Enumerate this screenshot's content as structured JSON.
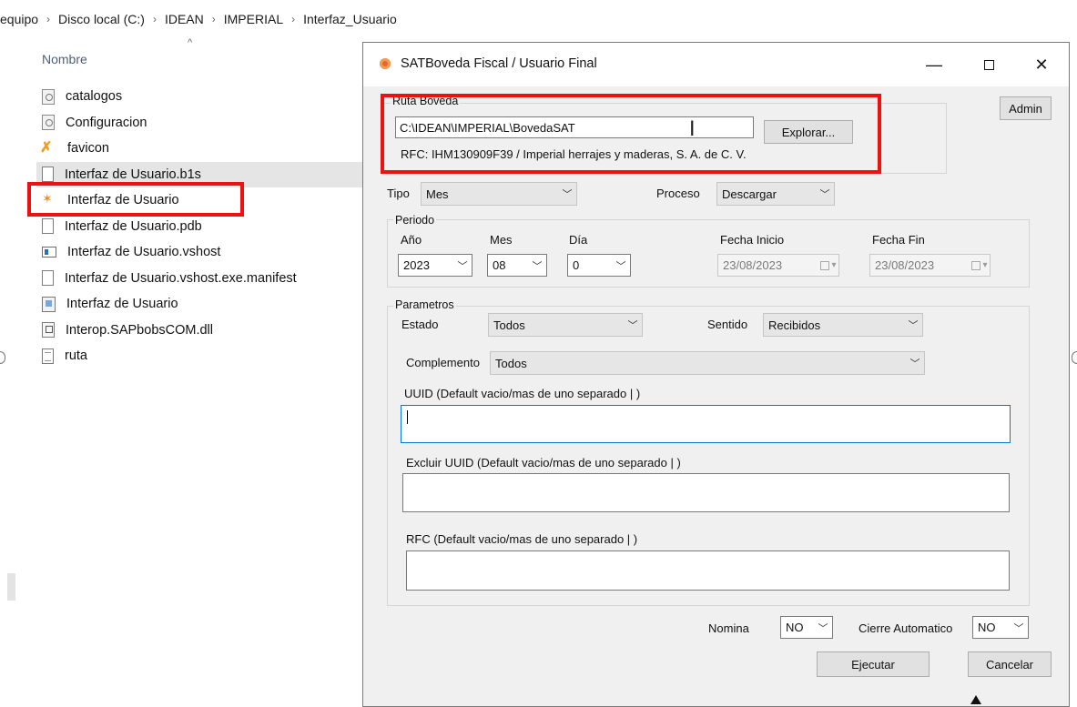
{
  "explorer": {
    "breadcrumb": [
      "equipo",
      "Disco local (C:)",
      "IDEAN",
      "IMPERIAL",
      "Interfaz_Usuario"
    ],
    "column_header": "Nombre",
    "files": [
      {
        "name": "catalogos",
        "icon": "config-file-icon"
      },
      {
        "name": "Configuracion",
        "icon": "config-file-icon"
      },
      {
        "name": "favicon",
        "icon": "favicon-icon"
      },
      {
        "name": "Interfaz de Usuario.b1s",
        "icon": "document-icon",
        "selected": true
      },
      {
        "name": "Interfaz de Usuario",
        "icon": "visual-studio-icon"
      },
      {
        "name": "Interfaz de Usuario.pdb",
        "icon": "document-icon"
      },
      {
        "name": "Interfaz de Usuario.vshost",
        "icon": "application-icon"
      },
      {
        "name": "Interfaz de Usuario.vshost.exe.manifest",
        "icon": "document-icon"
      },
      {
        "name": "Interfaz de Usuario",
        "icon": "dotnet-config-icon"
      },
      {
        "name": "Interop.SAPbobsCOM.dll",
        "icon": "dll-icon"
      },
      {
        "name": "ruta",
        "icon": "text-file-icon"
      }
    ]
  },
  "dialog": {
    "title": "SATBoveda Fiscal / Usuario Final",
    "admin_label": "Admin",
    "ruta": {
      "legend": "Ruta Boveda",
      "path_value": "C:\\IDEAN\\IMPERIAL\\BovedaSAT",
      "explore_label": "Explorar...",
      "rfc_text": "RFC: IHM130909F39 / Imperial herrajes y maderas, S. A. de C. V."
    },
    "tipo": {
      "label": "Tipo",
      "value": "Mes"
    },
    "proceso": {
      "label": "Proceso",
      "value": "Descargar"
    },
    "periodo": {
      "legend": "Periodo",
      "anio_label": "Año",
      "anio_value": "2023",
      "mes_label": "Mes",
      "mes_value": "08",
      "dia_label": "Día",
      "dia_value": "0",
      "fecha_inicio_label": "Fecha Inicio",
      "fecha_inicio_value": "23/08/2023",
      "fecha_fin_label": "Fecha Fin",
      "fecha_fin_value": "23/08/2023"
    },
    "parametros": {
      "legend": "Parametros",
      "estado_label": "Estado",
      "estado_value": "Todos",
      "sentido_label": "Sentido",
      "sentido_value": "Recibidos",
      "complemento_label": "Complemento",
      "complemento_value": "Todos",
      "uuid_label": "UUID (Default vacio/mas de uno separado | )",
      "uuid_value": "",
      "excluir_label": "Excluir UUID (Default vacio/mas de uno separado | )",
      "excluir_value": "",
      "rfc_label": "RFC (Default vacio/mas de uno separado | )",
      "rfc_value": ""
    },
    "nomina": {
      "label": "Nomina",
      "value": "NO"
    },
    "cierre": {
      "label": "Cierre Automatico",
      "value": "NO"
    },
    "ejecutar_label": "Ejecutar",
    "cancelar_label": "Cancelar"
  },
  "colors": {
    "highlight_box": "#ee1111",
    "focus_border": "#0078d7",
    "dialog_bg": "#f0f0f0"
  }
}
